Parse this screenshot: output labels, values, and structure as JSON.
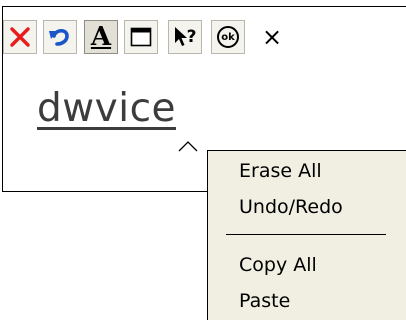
{
  "toolbar": {
    "buttons": [
      {
        "name": "close-edit-button",
        "icon": "red-x-icon"
      },
      {
        "name": "undo-button",
        "icon": "undo-arrow-icon"
      },
      {
        "name": "text-format-button",
        "icon": "letter-a-icon",
        "label": "A",
        "pressed": true
      },
      {
        "name": "window-button",
        "icon": "window-icon"
      },
      {
        "name": "help-button",
        "icon": "help-cursor-icon",
        "label": "?"
      },
      {
        "name": "ok-button",
        "icon": "ok-circle-icon",
        "label": "ok"
      },
      {
        "name": "close-button",
        "icon": "close-x-icon",
        "label": "×"
      }
    ]
  },
  "editor": {
    "recognized_word": "dwvice"
  },
  "context_menu": {
    "items": [
      "Erase All",
      "Undo/Redo",
      "Copy All",
      "Paste"
    ]
  },
  "colors": {
    "close_x": "#e81c1c",
    "undo_blue": "#1a56c8",
    "menu_bg": "#f1efe2",
    "button_bg": "#f4f3ee"
  }
}
